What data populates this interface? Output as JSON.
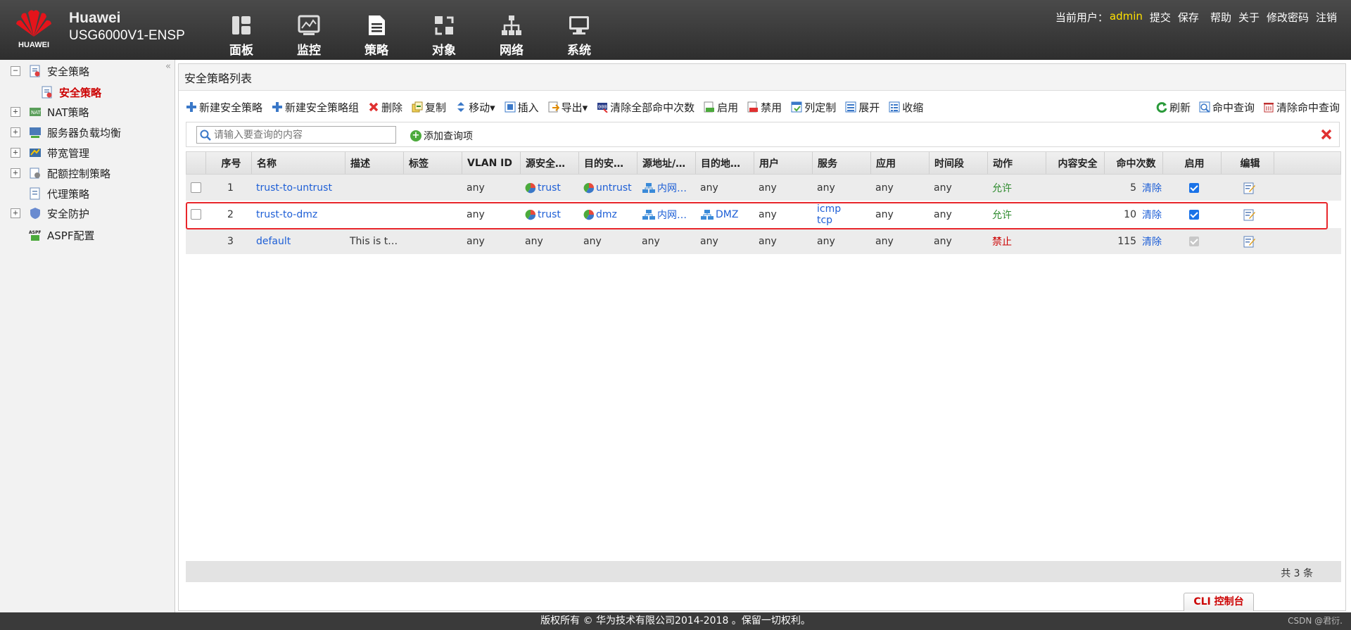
{
  "header": {
    "logo_text": "HUAWEI",
    "brand_line1": "Huawei",
    "brand_line2": "USG6000V1-ENSP",
    "nav": [
      {
        "label": "面板",
        "icon": "dashboard-icon"
      },
      {
        "label": "监控",
        "icon": "monitor-icon"
      },
      {
        "label": "策略",
        "icon": "policy-icon"
      },
      {
        "label": "对象",
        "icon": "object-icon"
      },
      {
        "label": "网络",
        "icon": "network-icon"
      },
      {
        "label": "系统",
        "icon": "system-icon"
      }
    ],
    "current_user_label": "当前用户：",
    "current_user": "admin",
    "links": [
      "提交",
      "保存",
      "帮助",
      "关于",
      "修改密码",
      "注销"
    ]
  },
  "sidebar": {
    "items": [
      {
        "label": "安全策略",
        "toggle": "−"
      },
      {
        "label": "安全策略",
        "toggle": "",
        "selected": true
      },
      {
        "label": "NAT策略",
        "toggle": "+"
      },
      {
        "label": "服务器负载均衡",
        "toggle": "+"
      },
      {
        "label": "带宽管理",
        "toggle": "+"
      },
      {
        "label": "配额控制策略",
        "toggle": "+"
      },
      {
        "label": "代理策略",
        "toggle": ""
      },
      {
        "label": "安全防护",
        "toggle": "+"
      },
      {
        "label": "ASPF配置",
        "toggle": ""
      }
    ],
    "collapse": "«"
  },
  "panel": {
    "title": "安全策略列表",
    "toolbar": {
      "new_policy": "新建安全策略",
      "new_group": "新建安全策略组",
      "delete": "删除",
      "copy": "复制",
      "move": "移动▾",
      "insert": "插入",
      "export": "导出▾",
      "clear_hits": "清除全部命中次数",
      "enable": "启用",
      "disable": "禁用",
      "columns": "列定制",
      "expand": "展开",
      "collapse": "收缩",
      "refresh": "刷新",
      "hit_query": "命中查询",
      "clear_hit_query": "清除命中查询"
    },
    "search": {
      "placeholder": "请输入要查询的内容",
      "add_filter": "添加查询项"
    },
    "table": {
      "headers": [
        "序号",
        "名称",
        "描述",
        "标签",
        "VLAN ID",
        "源安全…",
        "目的安…",
        "源地址/…",
        "目的地…",
        "用户",
        "服务",
        "应用",
        "时间段",
        "动作",
        "内容安全",
        "命中次数",
        "启用",
        "编辑"
      ],
      "rows": [
        {
          "no": "1",
          "name": "trust-to-untrust",
          "desc": "",
          "tag": "",
          "vlan": "any",
          "src_zone": "trust",
          "dst_zone": "untrust",
          "src_addr": "内网…",
          "dst_addr": "any",
          "user": "any",
          "service": "any",
          "service2": "",
          "app": "any",
          "time": "any",
          "action": "允许",
          "content": "",
          "hits": "5",
          "clear": "清除",
          "enabled": true
        },
        {
          "no": "2",
          "name": "trust-to-dmz",
          "desc": "",
          "tag": "",
          "vlan": "any",
          "src_zone": "trust",
          "dst_zone": "dmz",
          "src_addr": "内网…",
          "dst_addr": "DMZ",
          "user": "any",
          "service": "icmp",
          "service2": "tcp",
          "app": "any",
          "time": "any",
          "action": "允许",
          "content": "",
          "hits": "10",
          "clear": "清除",
          "enabled": true
        },
        {
          "no": "3",
          "name": "default",
          "desc": "This is t…",
          "tag": "",
          "vlan": "any",
          "src_zone": "any",
          "dst_zone": "any",
          "src_addr": "any",
          "dst_addr": "any",
          "user": "any",
          "service": "any",
          "service2": "",
          "app": "any",
          "time": "any",
          "action": "禁止",
          "content": "",
          "hits": "115",
          "clear": "清除",
          "enabled": true
        }
      ]
    },
    "total": "共 3 条"
  },
  "cli_button": "CLI 控制台",
  "footer": {
    "copyright": "版权所有 © 华为技术有限公司2014-2018 。保留一切权利。",
    "watermark": "CSDN @君衍."
  },
  "colors": {
    "accent": "#1e5fd6",
    "selected": "#cc0000",
    "allow": "#2e8b2e",
    "deny": "#cc0000",
    "highlight": "#e8262b"
  }
}
